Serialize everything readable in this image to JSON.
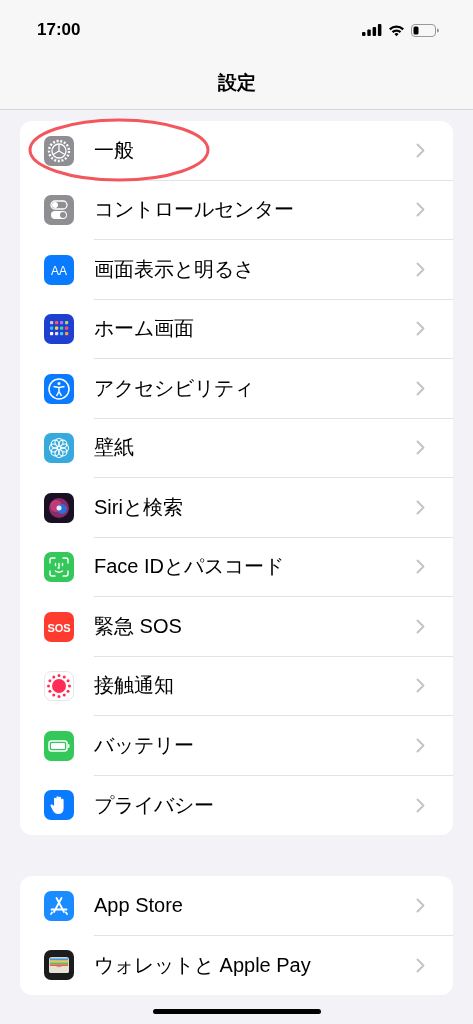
{
  "status_bar": {
    "time": "17:00"
  },
  "nav": {
    "title": "設定"
  },
  "groups": [
    {
      "items": [
        {
          "label": "一般",
          "circled": true
        },
        {
          "label": "コントロールセンター",
          "circled": false
        },
        {
          "label": "画面表示と明るさ",
          "icon_label": "AA",
          "circled": false
        },
        {
          "label": "ホーム画面",
          "circled": false
        },
        {
          "label": "アクセシビリティ",
          "circled": false
        },
        {
          "label": "壁紙",
          "circled": false
        },
        {
          "label": "Siriと検索",
          "circled": false
        },
        {
          "label": "Face IDとパスコード",
          "circled": false
        },
        {
          "label": "緊急 SOS",
          "icon_label": "SOS",
          "circled": false
        },
        {
          "label": "接触通知",
          "circled": false
        },
        {
          "label": "バッテリー",
          "circled": false
        },
        {
          "label": "プライバシー",
          "circled": false
        }
      ]
    },
    {
      "items": [
        {
          "label": "App Store",
          "circled": false
        },
        {
          "label": "ウォレットと Apple Pay",
          "circled": false
        }
      ]
    }
  ]
}
